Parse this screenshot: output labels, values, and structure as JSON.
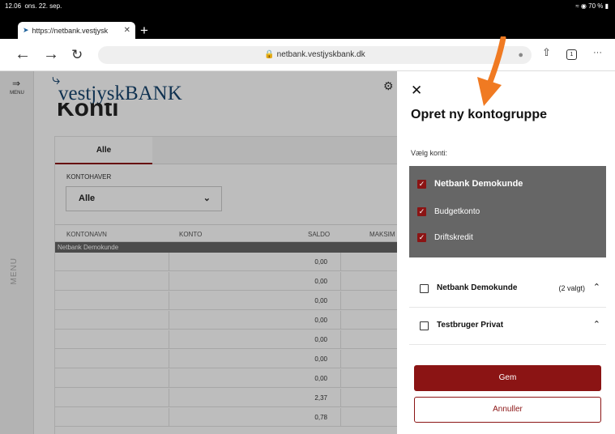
{
  "status_bar": {
    "time": "12.06",
    "date": "ons. 22. sep.",
    "battery": "70 %"
  },
  "browser": {
    "tab_title": "https://netbank.vestjysk",
    "url": "netbank.vestjyskbank.dk",
    "tab_count": "1"
  },
  "app": {
    "logo_text": "vestjyskBANK",
    "menu_label": "MENU",
    "side_menu_label": "MENU",
    "page_title": "Konti",
    "tab_all": "Alle",
    "owner_label": "KONTOHAVER",
    "owner_value": "Alle",
    "columns": [
      "KONTONAVN",
      "KONTO",
      "SALDO",
      "MAKSIM"
    ],
    "group_label": "Netbank Demokunde",
    "saldo_values": [
      "0,00",
      "0,00",
      "0,00",
      "0,00",
      "0,00",
      "0,00",
      "0,00",
      "2,37",
      "0,78"
    ]
  },
  "panel": {
    "title": "Opret ny kontogruppe",
    "subtitle": "Vælg konti:",
    "selected_items": [
      {
        "label": "Netbank Demokunde",
        "bold": true
      },
      {
        "label": "Budgetkonto",
        "bold": false
      },
      {
        "label": "Driftskredit",
        "bold": false
      }
    ],
    "groups": [
      {
        "label": "Netbank Demokunde",
        "selected_note": "(2 valgt)"
      },
      {
        "label": "Testbruger Privat",
        "selected_note": ""
      }
    ],
    "save_label": "Gem",
    "cancel_label": "Annuller"
  },
  "colors": {
    "brand": "#8b1414",
    "logo": "#16446e",
    "annotation_arrow": "#f07a22"
  }
}
